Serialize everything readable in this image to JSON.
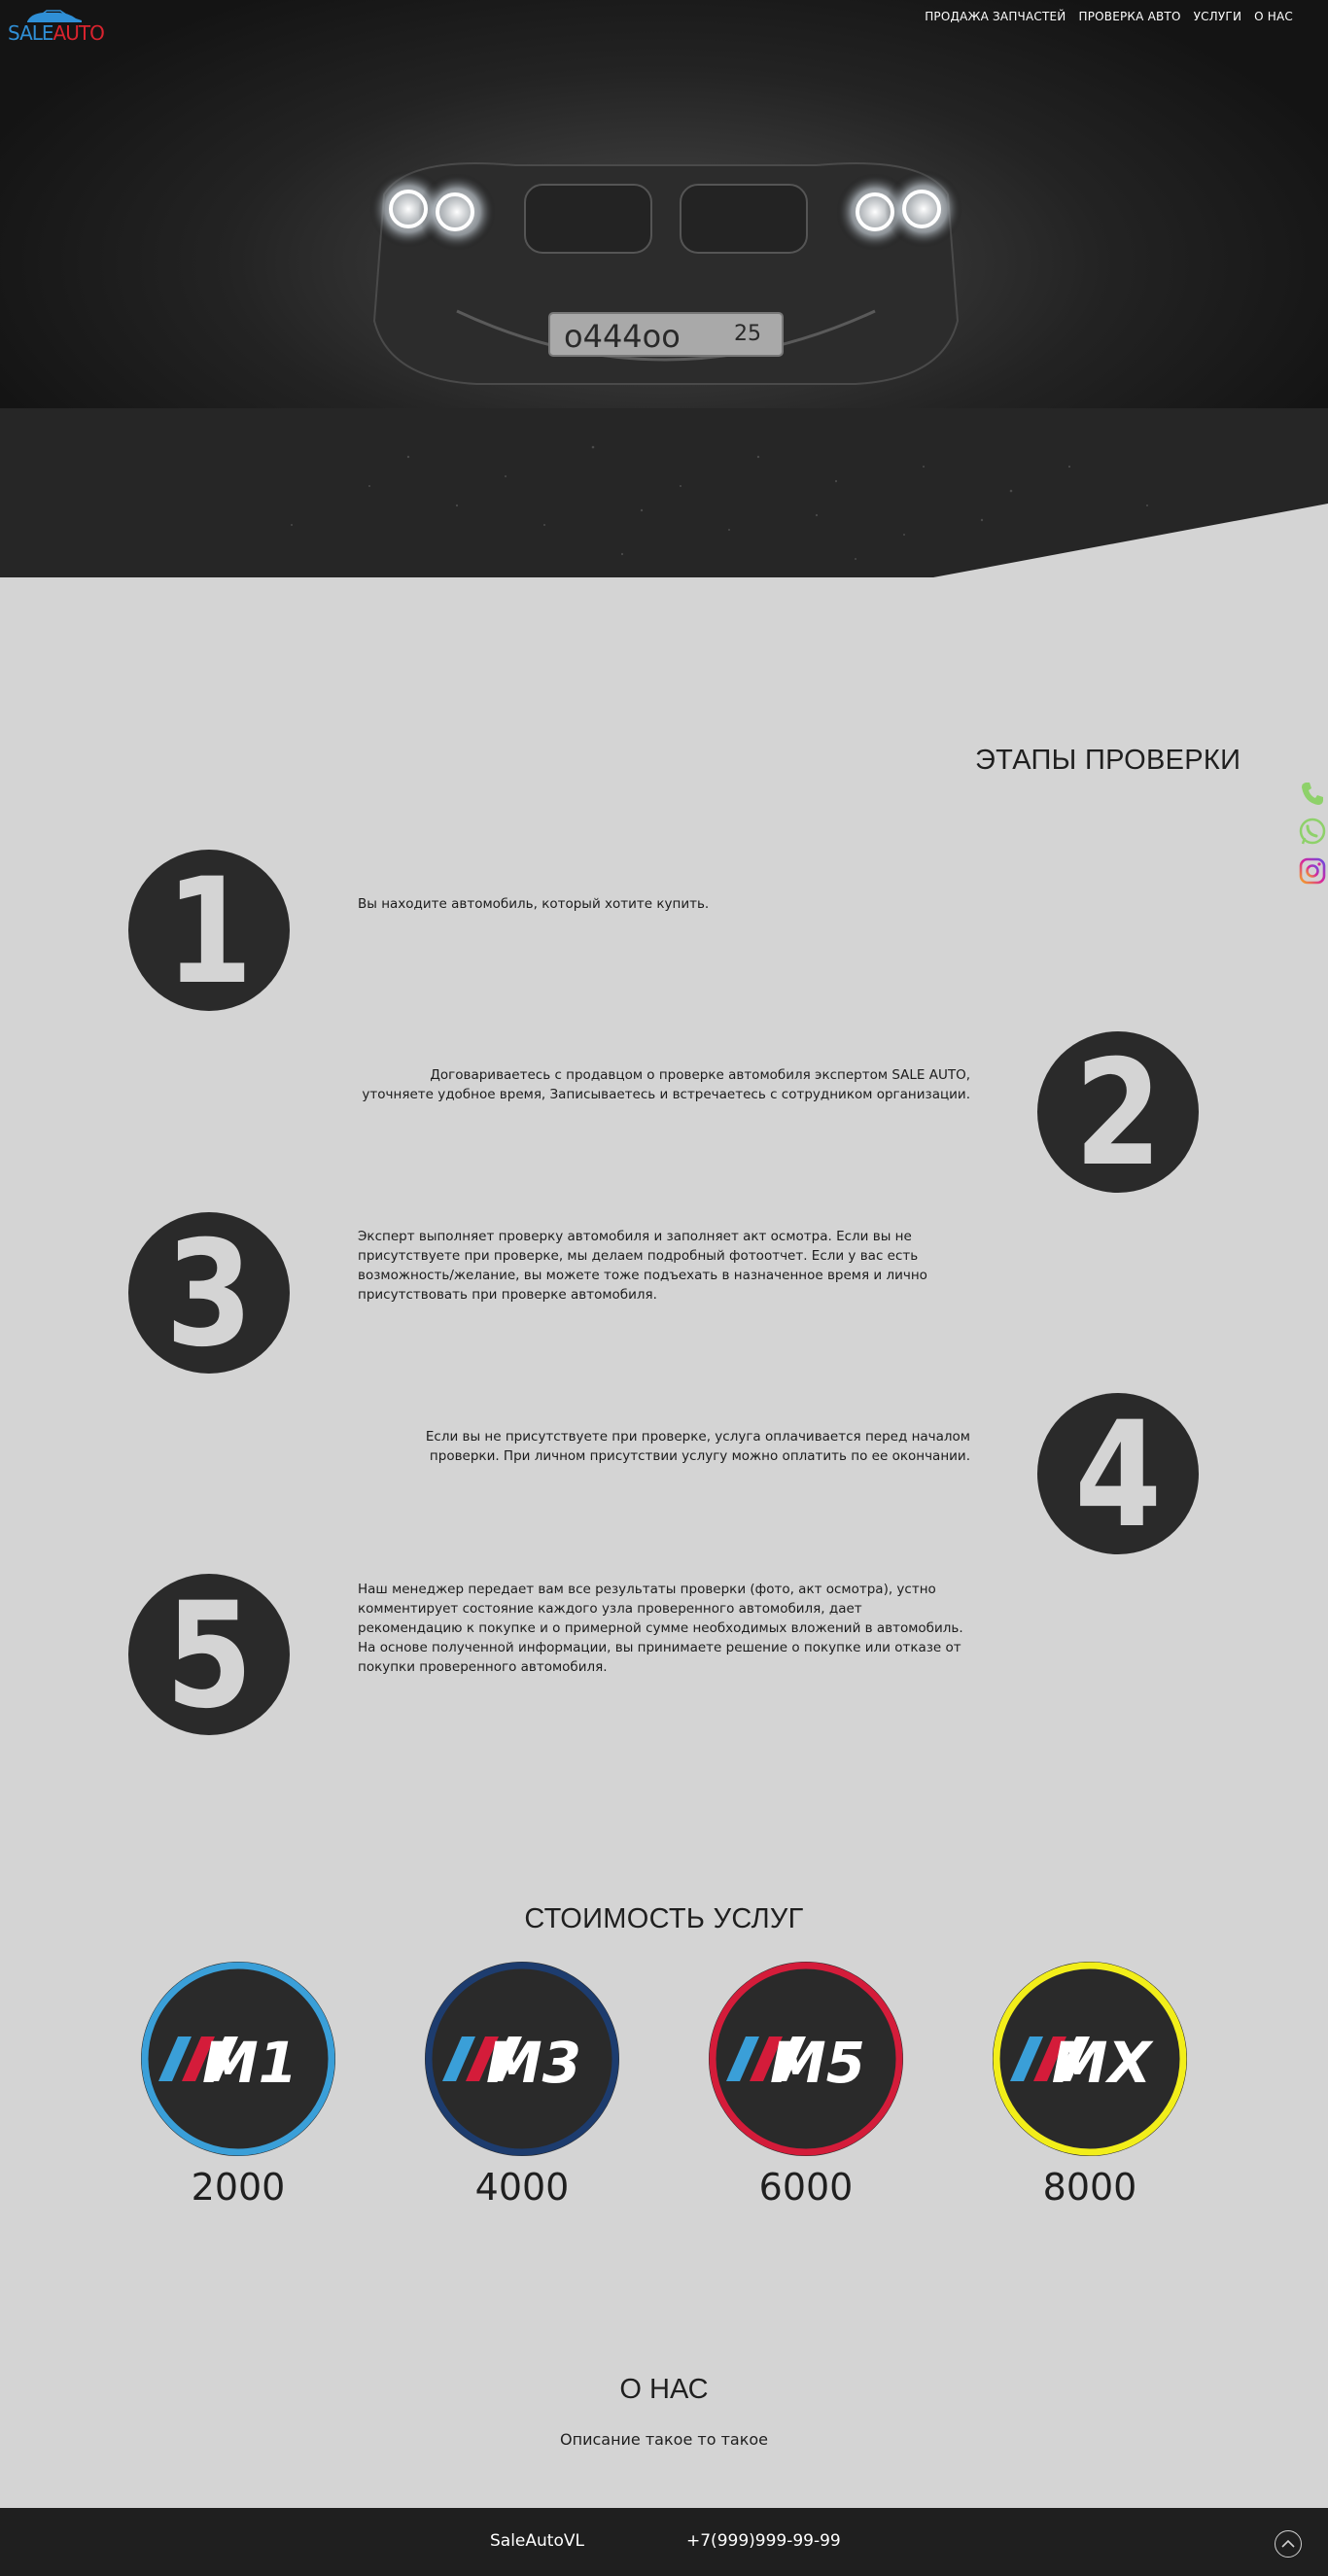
{
  "header": {
    "logo": {
      "part1": "SALE",
      "part2": "AUTO"
    },
    "nav": [
      {
        "label": "ПРОДАЖА ЗАПЧАСТЕЙ"
      },
      {
        "label": "ПРОВЕРКА АВТО"
      },
      {
        "label": "УСЛУГИ"
      },
      {
        "label": "О НАС"
      }
    ]
  },
  "hero": {
    "plate": "о444оо",
    "region": "25"
  },
  "steps": {
    "title": "ЭТАПЫ ПРОВЕРКИ",
    "items": [
      {
        "number": "1",
        "text": "Вы находите автомобиль, который хотите купить."
      },
      {
        "number": "2",
        "text": "Договариваетесь с продавцом о проверке автомобиля экспертом SALE AUTO, уточняете удобное время, Записываетесь и встречаетесь с сотрудником организации."
      },
      {
        "number": "3",
        "text": "Эксперт выполняет проверку автомобиля и заполняет акт осмотра. Если вы не присутствуете при проверке, мы делаем подробный фотоотчет. Если у вас есть возможность/желание, вы можете тоже подъехать в назначенное время и лично присутствовать при проверке автомобиля."
      },
      {
        "number": "4",
        "text": "Если вы не присутствуете при проверке, услуга оплачивается перед началом проверки. При личном присутствии услугу можно оплатить по ее окончании."
      },
      {
        "number": "5",
        "text": "Наш менеджер передает вам все результаты проверки (фото, акт осмотра), устно комментирует состояние каждого узла проверенного автомобиля, дает рекомендацию к покупке и о примерной сумме необходимых вложений в автомобиль.\nНа основе полученной информации, вы принимаете решение о покупке или отказе от покупки проверенного автомобиля."
      }
    ]
  },
  "prices": {
    "title": "СТОИМОСТЬ УСЛУГ",
    "items": [
      {
        "badge": "M1",
        "price": "2000",
        "ring_color": "#3a9fd8"
      },
      {
        "badge": "M3",
        "price": "4000",
        "ring_color": "#1d3c6e"
      },
      {
        "badge": "M5",
        "price": "6000",
        "ring_color": "#d41c3a"
      },
      {
        "badge": "MX",
        "price": "8000",
        "ring_color": "#f2ee1a"
      }
    ],
    "stripe_colors": [
      "#3a9fd8",
      "#d41c3a",
      "#ffffff"
    ]
  },
  "about": {
    "title": "О НАС",
    "description": "Описание такое то такое"
  },
  "footer": {
    "brand": "SaleAutoVL",
    "phone": "+7(999)999-99-99"
  },
  "side_icons": [
    "phone-icon",
    "whatsapp-icon",
    "instagram-icon"
  ],
  "colors": {
    "accent_blue": "#2f8fd6",
    "accent_red": "#d9232e",
    "dark": "#2a2a2a",
    "background": "#d4d4d4"
  }
}
